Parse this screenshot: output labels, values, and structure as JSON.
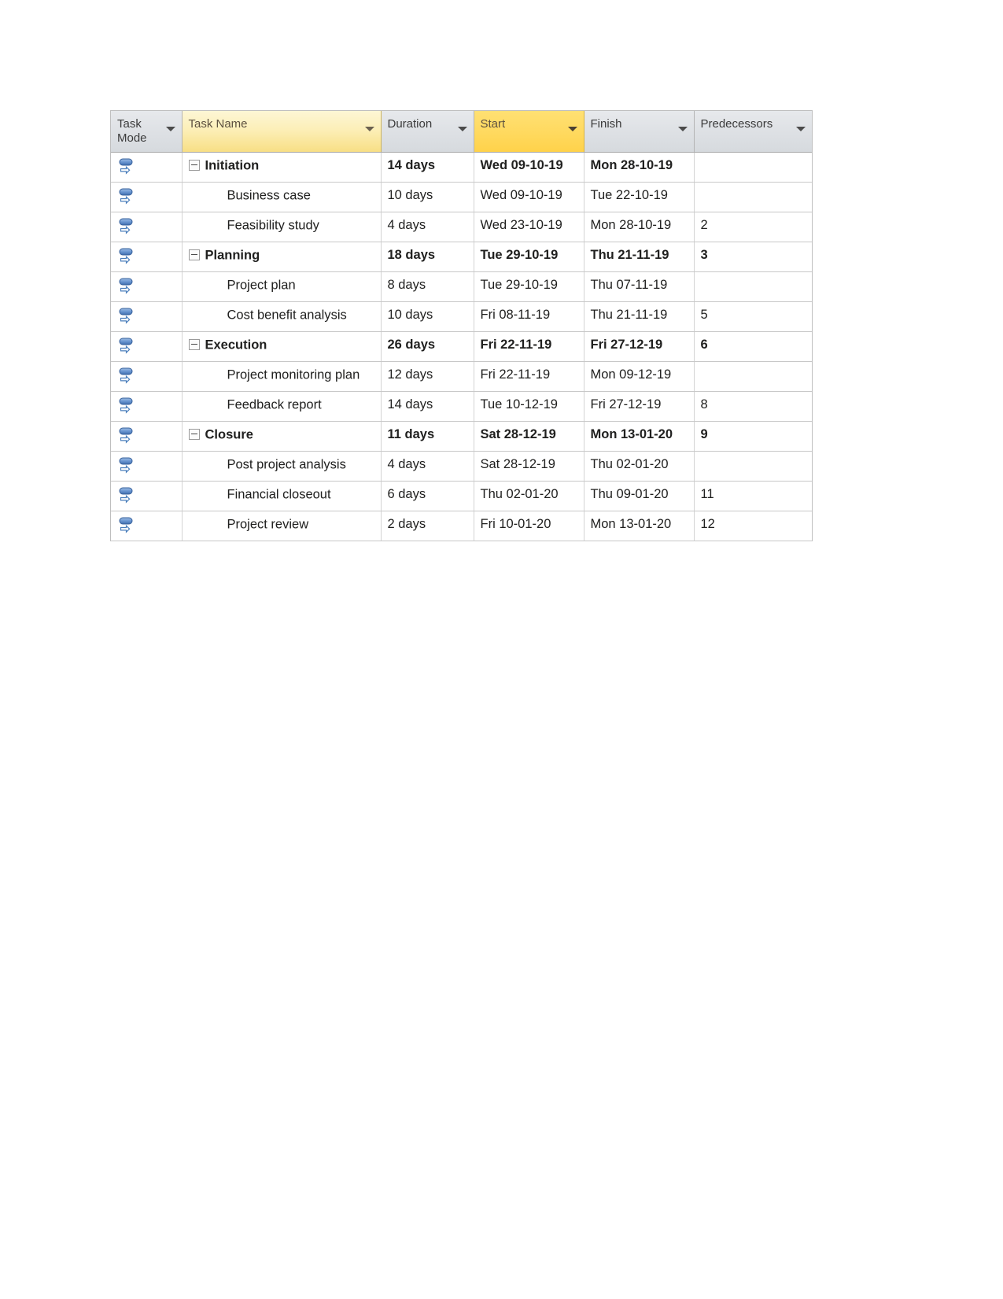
{
  "table": {
    "name": "project-schedule-table",
    "columns": [
      {
        "key": "mode",
        "label": "Task Mode",
        "highlighted": false,
        "has_filter_arrow": true
      },
      {
        "key": "name",
        "label": "Task Name",
        "highlighted": true,
        "has_filter_arrow": true
      },
      {
        "key": "dur",
        "label": "Duration",
        "highlighted": false,
        "has_filter_arrow": true
      },
      {
        "key": "start",
        "label": "Start",
        "highlighted": true,
        "has_filter_arrow": true
      },
      {
        "key": "fin",
        "label": "Finish",
        "highlighted": false,
        "has_filter_arrow": true
      },
      {
        "key": "pred",
        "label": "Predecessors",
        "highlighted": false,
        "has_filter_arrow": true
      }
    ],
    "rows": [
      {
        "mode_icon": "auto-scheduled-icon",
        "summary": true,
        "indent": 0,
        "collapse": "minus",
        "name": "Initiation",
        "duration": "14 days",
        "start": "Wed 09-10-19",
        "finish": "Mon 28-10-19",
        "predecessors": ""
      },
      {
        "mode_icon": "auto-scheduled-icon",
        "summary": false,
        "indent": 1,
        "collapse": "",
        "name": "Business case",
        "duration": "10 days",
        "start": "Wed 09-10-19",
        "finish": "Tue 22-10-19",
        "predecessors": ""
      },
      {
        "mode_icon": "auto-scheduled-icon",
        "summary": false,
        "indent": 1,
        "collapse": "",
        "name": "Feasibility study",
        "duration": "4 days",
        "start": "Wed 23-10-19",
        "finish": "Mon 28-10-19",
        "predecessors": "2"
      },
      {
        "mode_icon": "auto-scheduled-icon",
        "summary": true,
        "indent": 0,
        "collapse": "minus",
        "name": "Planning",
        "duration": "18 days",
        "start": "Tue 29-10-19",
        "finish": "Thu 21-11-19",
        "predecessors": "3"
      },
      {
        "mode_icon": "auto-scheduled-icon",
        "summary": false,
        "indent": 1,
        "collapse": "",
        "name": "Project plan",
        "duration": "8 days",
        "start": "Tue 29-10-19",
        "finish": "Thu 07-11-19",
        "predecessors": ""
      },
      {
        "mode_icon": "auto-scheduled-icon",
        "summary": false,
        "indent": 1,
        "collapse": "",
        "name": "Cost benefit analysis",
        "duration": "10 days",
        "start": "Fri 08-11-19",
        "finish": "Thu 21-11-19",
        "predecessors": "5"
      },
      {
        "mode_icon": "auto-scheduled-icon",
        "summary": true,
        "indent": 0,
        "collapse": "minus",
        "name": "Execution",
        "duration": "26 days",
        "start": "Fri 22-11-19",
        "finish": "Fri 27-12-19",
        "predecessors": "6"
      },
      {
        "mode_icon": "auto-scheduled-icon",
        "summary": false,
        "indent": 1,
        "collapse": "",
        "name": "Project monitoring plan",
        "duration": "12 days",
        "start": "Fri 22-11-19",
        "finish": "Mon 09-12-19",
        "predecessors": ""
      },
      {
        "mode_icon": "auto-scheduled-icon",
        "summary": false,
        "indent": 1,
        "collapse": "",
        "name": "Feedback report",
        "duration": "14 days",
        "start": "Tue 10-12-19",
        "finish": "Fri 27-12-19",
        "predecessors": "8"
      },
      {
        "mode_icon": "auto-scheduled-icon",
        "summary": true,
        "indent": 0,
        "collapse": "minus",
        "name": "Closure",
        "duration": "11 days",
        "start": "Sat 28-12-19",
        "finish": "Mon 13-01-20",
        "predecessors": "9"
      },
      {
        "mode_icon": "auto-scheduled-icon",
        "summary": false,
        "indent": 1,
        "collapse": "",
        "name": "Post project analysis",
        "duration": "4 days",
        "start": "Sat 28-12-19",
        "finish": "Thu 02-01-20",
        "predecessors": ""
      },
      {
        "mode_icon": "auto-scheduled-icon",
        "summary": false,
        "indent": 1,
        "collapse": "",
        "name": "Financial closeout",
        "duration": "6 days",
        "start": "Thu 02-01-20",
        "finish": "Thu 09-01-20",
        "predecessors": "11"
      },
      {
        "mode_icon": "auto-scheduled-icon",
        "summary": false,
        "indent": 1,
        "collapse": "",
        "name": "Project review",
        "duration": "2 days",
        "start": "Fri 10-01-20",
        "finish": "Mon 13-01-20",
        "predecessors": "12"
      }
    ]
  },
  "colors": {
    "header_gray": "#dde0e4",
    "header_name_yellow": "#fcefb8",
    "header_start_gold": "#ffd95e",
    "grid_line": "#c8c8c8",
    "icon_blue": "#4a7ebb",
    "text": "#20201f"
  }
}
